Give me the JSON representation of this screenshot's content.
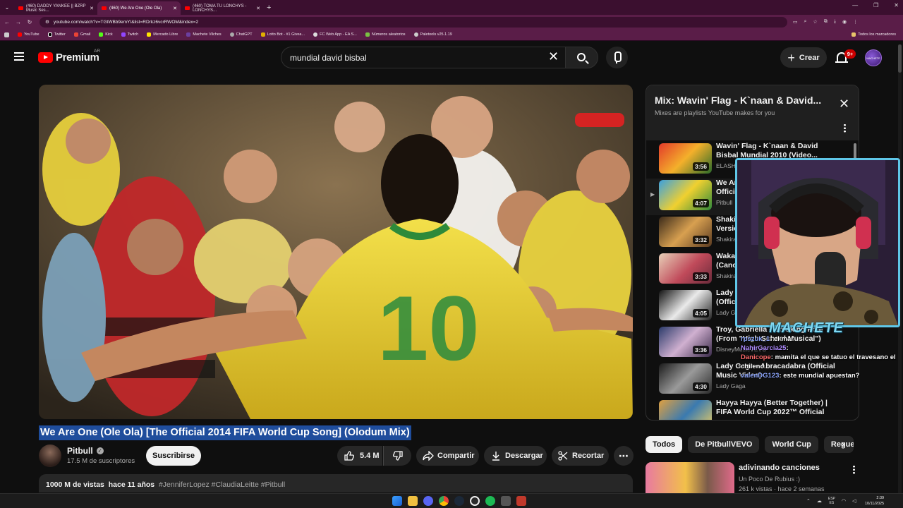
{
  "browser": {
    "tabs": [
      {
        "title": "(460) DADDY YANKEE || BZRP Music Ses...",
        "active": false
      },
      {
        "title": "(460) We Are One (Ole Ola)",
        "active": true
      },
      {
        "title": "(460) TOMA TU LONCHYS - LONCHYS...",
        "active": false
      }
    ],
    "url": "youtube.com/watch?v=TGtWBb9emYI&list=RDrkz6vcrRWOM&index=2",
    "bookmarks": [
      "YouTube",
      "Twitter",
      "Gmail",
      "Kick",
      "Twitch",
      "Mercado Libre",
      "Machete Vilches",
      "ChatGPT",
      "Lotto Bot - #1 Givea...",
      "FC Web App - EA S...",
      "Números aleatorios",
      "Paletools v25.1.19"
    ],
    "all_bookmarks": "Todos los marcadores"
  },
  "header": {
    "logo_text": "Premium",
    "region": "AR",
    "search_value": "mundial david bisbal",
    "create_label": "Crear",
    "notif_badge": "9+",
    "avatar_text": "MACHETE"
  },
  "video": {
    "title": "We Are One (Ole Ola) [The Official 2014 FIFA World Cup Song] (Olodum Mix)",
    "channel": "Pitbull",
    "subscribers": "17.5 M de suscriptores",
    "subscribe_label": "Suscribirse",
    "likes": "5.4 M",
    "share_label": "Compartir",
    "download_label": "Descargar",
    "clip_label": "Recortar",
    "views": "1000 M de vistas",
    "age": "hace 11 años",
    "tags": "#JenniferLopez #ClaudiaLeitte #Pitbull"
  },
  "mix": {
    "title": "Mix: Wavin' Flag - K`naan & David...",
    "subtitle": "Mixes are playlists YouTube makes for you",
    "items": [
      {
        "title": "Wavin' Flag - K`naan & David Bisbal Mundial 2010 (Video...",
        "channel": "ELASH...",
        "duration": "3:56",
        "now": ""
      },
      {
        "title": "We Are One (Ole Ola) [The Official...",
        "channel": "Pitbull",
        "duration": "4:07",
        "now": "▶"
      },
      {
        "title": "Shakira - La La La (Spanish Version)",
        "channel": "Shakira",
        "duration": "3:32",
        "now": ""
      },
      {
        "title": "Waka Waka (This Time for Africa) (Canción...",
        "channel": "Shakira",
        "duration": "3:33",
        "now": ""
      },
      {
        "title": "Lady Gaga - Bad Romance (Official Music Video)",
        "channel": "Lady Gaga",
        "duration": "4:05",
        "now": ""
      },
      {
        "title": "Troy, Gabriella - Breaking Free (From \"High School Musical\")",
        "channel": "DisneyMusicVEVO",
        "duration": "3:36",
        "now": ""
      },
      {
        "title": "Lady Gaga - Abracadabra (Official Music Video)",
        "channel": "Lady Gaga",
        "duration": "4:30",
        "now": ""
      },
      {
        "title": "Hayya Hayya (Better Together) | FIFA World Cup 2022™ Official",
        "channel": "",
        "duration": "",
        "now": ""
      }
    ]
  },
  "stream_overlay": {
    "name_tag": "MACHETE",
    "chat": [
      {
        "user": "rpszuk_1",
        "text": "el mar"
      },
      {
        "user": "NahirGarcia25",
        "text": ""
      },
      {
        "user": "Danicope",
        "text": "mamita el que se tatuo el travesano el chileno"
      },
      {
        "user": "valenDG123",
        "text": "este mundial apuestan?"
      }
    ]
  },
  "chips": [
    "Todos",
    "De PitbullVEVO",
    "World Cup",
    "Reguetón"
  ],
  "recommended": {
    "title": "adivinando canciones",
    "channel": "Un Poco De Rubius :)",
    "meta": "261 k vistas · hace 2 semanas"
  },
  "taskbar": {
    "lang": "ESP",
    "lang2": "ES",
    "time": "2:39",
    "date": "10/11/2025"
  }
}
